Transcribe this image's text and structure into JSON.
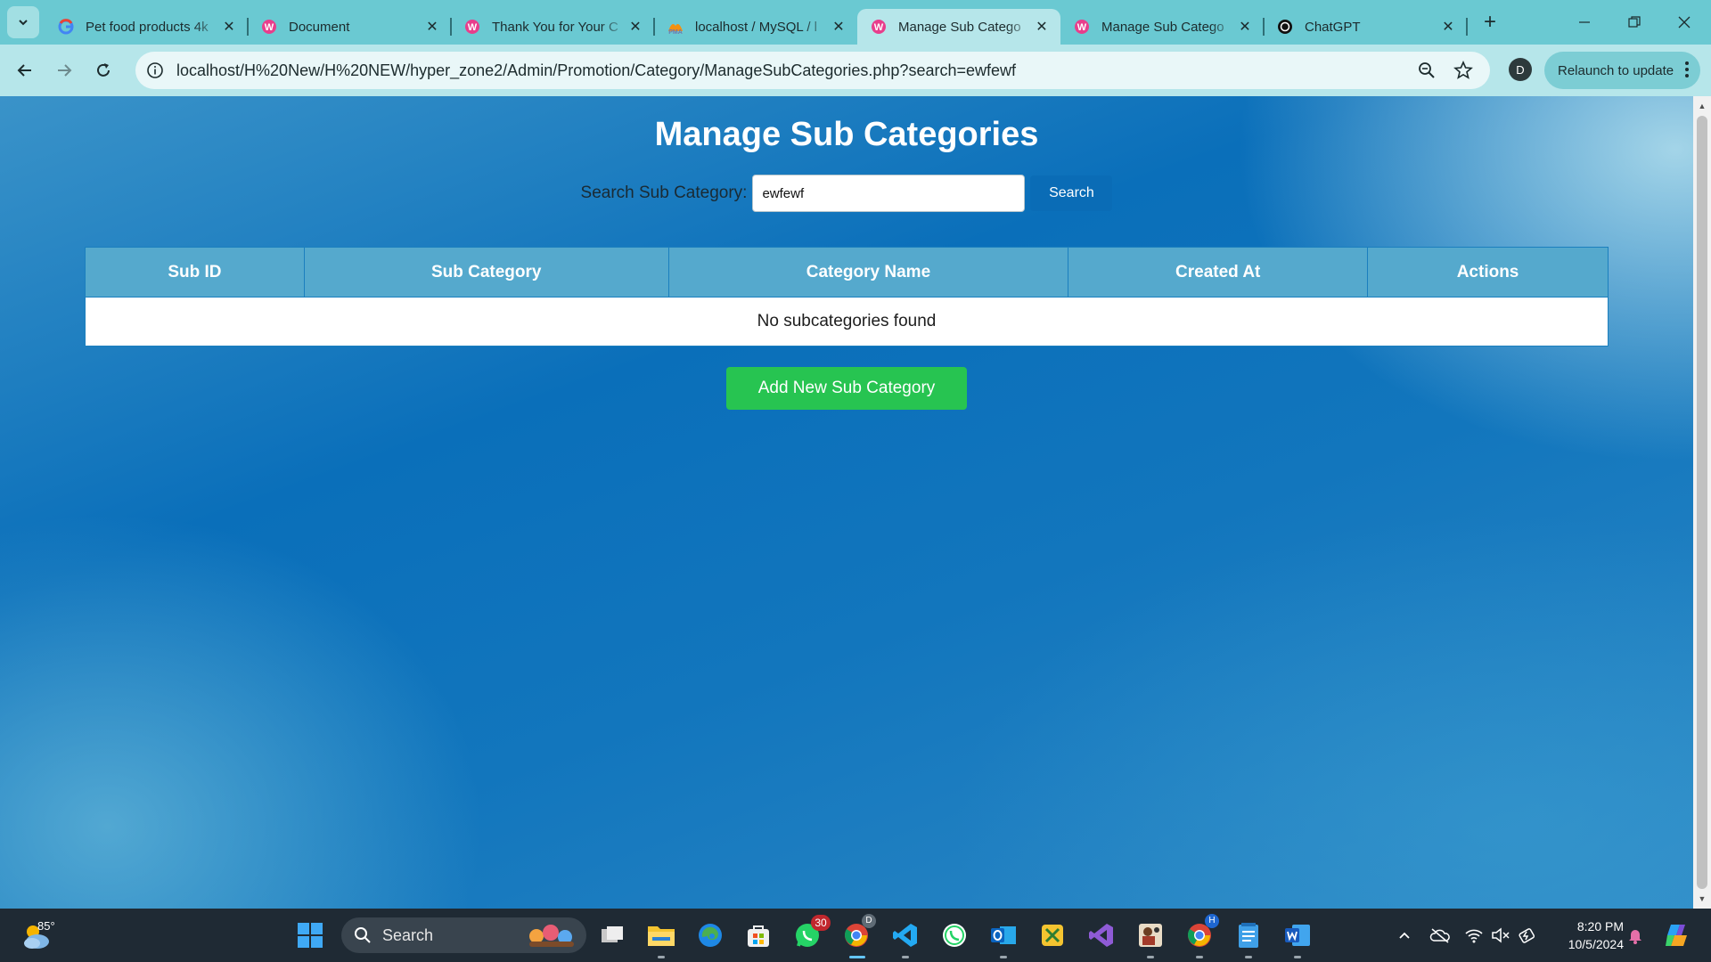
{
  "browser": {
    "tabs": [
      {
        "title": "Pet food products 4k",
        "icon": "google-icon"
      },
      {
        "title": "Document",
        "icon": "wamp-icon"
      },
      {
        "title": "Thank You for Your C",
        "icon": "wamp-icon"
      },
      {
        "title": "localhost / MySQL / l",
        "icon": "phpmyadmin-icon"
      },
      {
        "title": "Manage Sub Catego",
        "icon": "wamp-icon",
        "active": true
      },
      {
        "title": "Manage Sub Catego",
        "icon": "wamp-icon"
      },
      {
        "title": "ChatGPT",
        "icon": "chatgpt-icon"
      }
    ],
    "url": "localhost/H%20New/H%20NEW/hyper_zone2/Admin/Promotion/Category/ManageSubCategories.php?search=ewfewf",
    "profile_initial": "D",
    "relaunch_label": "Relaunch to update"
  },
  "page": {
    "title": "Manage Sub Categories",
    "search_label": "Search Sub Category:",
    "search_value": "ewfewf",
    "search_button": "Search",
    "table": {
      "columns": [
        "Sub ID",
        "Sub Category",
        "Category Name",
        "Created At",
        "Actions"
      ],
      "empty_message": "No subcategories found"
    },
    "add_button": "Add New Sub Category"
  },
  "taskbar": {
    "weather_temp": "85°",
    "search_label": "Search",
    "whatsapp_badge": "30",
    "chrome_profile_badge": "D",
    "chrome2_profile_badge": "H",
    "time": "8:20 PM",
    "date": "10/5/2024"
  },
  "colors": {
    "header_bg": "#55a9cd",
    "search_button": "#0a6cb6",
    "add_button": "#27c451",
    "browser_frame": "#6ac9d2"
  }
}
